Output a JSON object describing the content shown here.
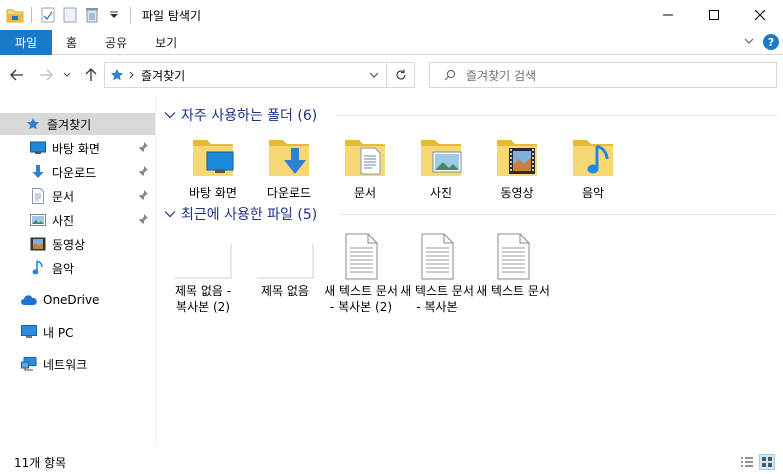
{
  "window": {
    "title": "파일 탐색기"
  },
  "ribbon": {
    "tabs": [
      "파일",
      "홈",
      "공유",
      "보기"
    ]
  },
  "address": {
    "location": "즐겨찾기",
    "search_placeholder": "즐겨찾기 검색"
  },
  "sidebar": {
    "items": [
      {
        "label": "즐겨찾기",
        "icon": "star-icon"
      },
      {
        "label": "바탕 화면",
        "icon": "desktop-icon",
        "pinned": true
      },
      {
        "label": "다운로드",
        "icon": "download-icon",
        "pinned": true
      },
      {
        "label": "문서",
        "icon": "document-icon",
        "pinned": true
      },
      {
        "label": "사진",
        "icon": "picture-icon",
        "pinned": true
      },
      {
        "label": "동영상",
        "icon": "video-icon"
      },
      {
        "label": "음악",
        "icon": "music-icon"
      },
      {
        "label": "OneDrive",
        "icon": "cloud-icon"
      },
      {
        "label": "내 PC",
        "icon": "computer-icon"
      },
      {
        "label": "네트워크",
        "icon": "network-icon"
      }
    ]
  },
  "frequent": {
    "title": "자주 사용하는 폴더 (6)",
    "folders": [
      {
        "name": "바탕 화면",
        "icon": "desktop-folder-icon"
      },
      {
        "name": "다운로드",
        "icon": "download-folder-icon"
      },
      {
        "name": "문서",
        "icon": "documents-folder-icon"
      },
      {
        "name": "사진",
        "icon": "pictures-folder-icon"
      },
      {
        "name": "동영상",
        "icon": "videos-folder-icon"
      },
      {
        "name": "음악",
        "icon": "music-folder-icon"
      }
    ]
  },
  "recent": {
    "title": "최근에 사용한 파일 (5)",
    "files": [
      {
        "name": "제목 없음 - 복사본 (2)",
        "icon": "blank-image-icon"
      },
      {
        "name": "제목 없음",
        "icon": "blank-image-icon"
      },
      {
        "name": "새 텍스트 문서 - 복사본 (2)",
        "icon": "text-file-icon"
      },
      {
        "name": "새 텍스트 문서 - 복사본",
        "icon": "text-file-icon"
      },
      {
        "name": "새 텍스트 문서",
        "icon": "text-file-icon"
      }
    ]
  },
  "status": {
    "item_count": "11개 항목"
  },
  "colors": {
    "accent": "#1979ca",
    "folder": "#f8d775",
    "group_heading": "#1e3287"
  }
}
